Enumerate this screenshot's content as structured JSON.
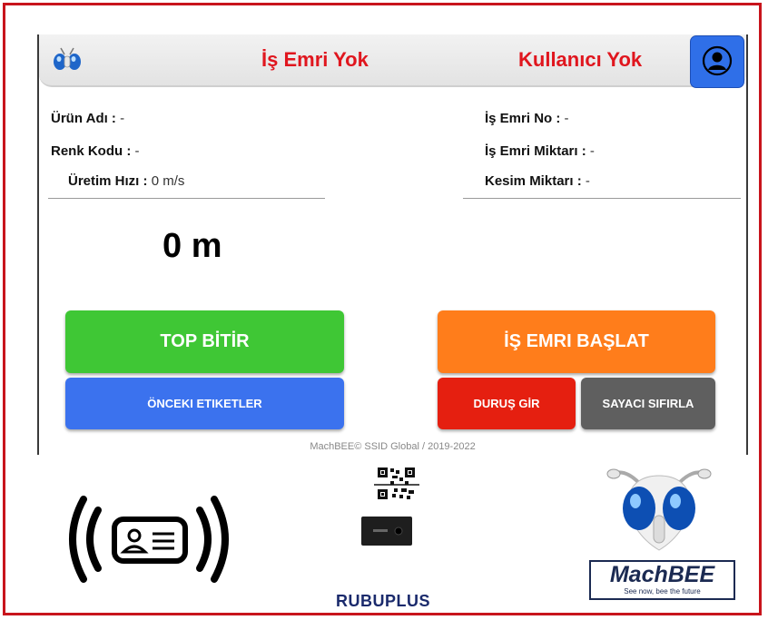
{
  "header": {
    "work_order_status": "İş Emri Yok",
    "user_status": "Kullanıcı Yok"
  },
  "left_info": {
    "product_name_label": "Ürün Adı :",
    "product_name_value": "-",
    "color_code_label": "Renk Kodu :",
    "color_code_value": "-",
    "speed_label": "Üretim Hızı :",
    "speed_value": "0 m/s"
  },
  "right_info": {
    "work_order_no_label": "İş Emri No :",
    "work_order_no_value": "-",
    "work_order_qty_label": "İş Emri Miktarı :",
    "work_order_qty_value": "-",
    "cut_qty_label": "Kesim Miktarı :",
    "cut_qty_value": "-"
  },
  "meter_reading": "0 m",
  "buttons": {
    "finish_roll": "TOP BİTİR",
    "start_work_order": "İŞ EMRI BAŞLAT",
    "previous_labels": "ÖNCEKI ETIKETLER",
    "enter_stop": "DURUŞ GİR",
    "reset_counter": "SAYACI SIFIRLA"
  },
  "footer": "MachBEE© SSID Global / 2019-2022",
  "brands": {
    "rubu": "RUBUPLUS",
    "machbee": "MachBEE",
    "machbee_tagline": "See now, bee the future"
  },
  "icons": {
    "rfid": "rfid-card-icon",
    "qr": "qr-code-icon",
    "reader": "card-reader-icon",
    "user": "user-icon"
  },
  "colors": {
    "accent_red": "#e0161e",
    "green": "#3fc735",
    "orange": "#ff7d1b",
    "blue": "#3b72ee",
    "red": "#e51f10",
    "gray": "#5f5f5f"
  }
}
